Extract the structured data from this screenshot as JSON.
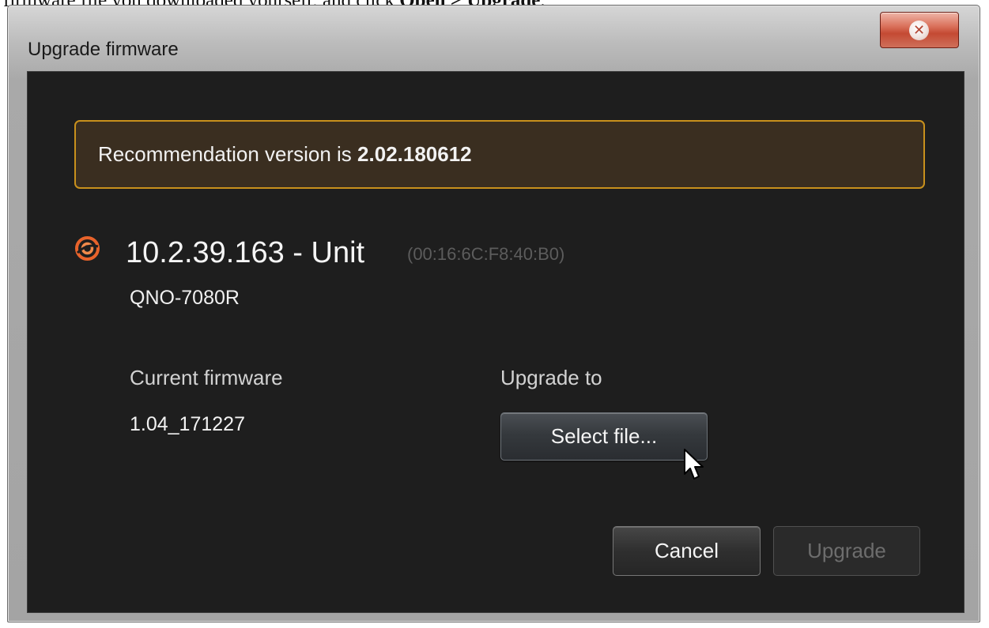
{
  "caption": {
    "prefix": "firmware file you downloaded yourself, and click ",
    "open": "Open",
    "separator": " > ",
    "upgrade": "Upgrade",
    "suffix": "."
  },
  "window": {
    "title": "Upgrade firmware",
    "close_icon": "close-icon"
  },
  "banner": {
    "prefix": "Recommendation version is ",
    "version": "2.02.180612",
    "accent_color": "#c8901c"
  },
  "device": {
    "icon": "camera-unit-icon",
    "title": "10.2.39.163 - Unit",
    "mac": "(00:16:6C:F8:40:B0)",
    "model": "QNO-7080R",
    "icon_color": "#e8632b"
  },
  "firmware": {
    "current_label": "Current firmware",
    "current_value": "1.04_171227",
    "upgrade_label": "Upgrade to",
    "select_file_label": "Select file..."
  },
  "actions": {
    "cancel_label": "Cancel",
    "upgrade_label": "Upgrade"
  },
  "pointer": {
    "icon": "mouse-cursor-icon"
  }
}
